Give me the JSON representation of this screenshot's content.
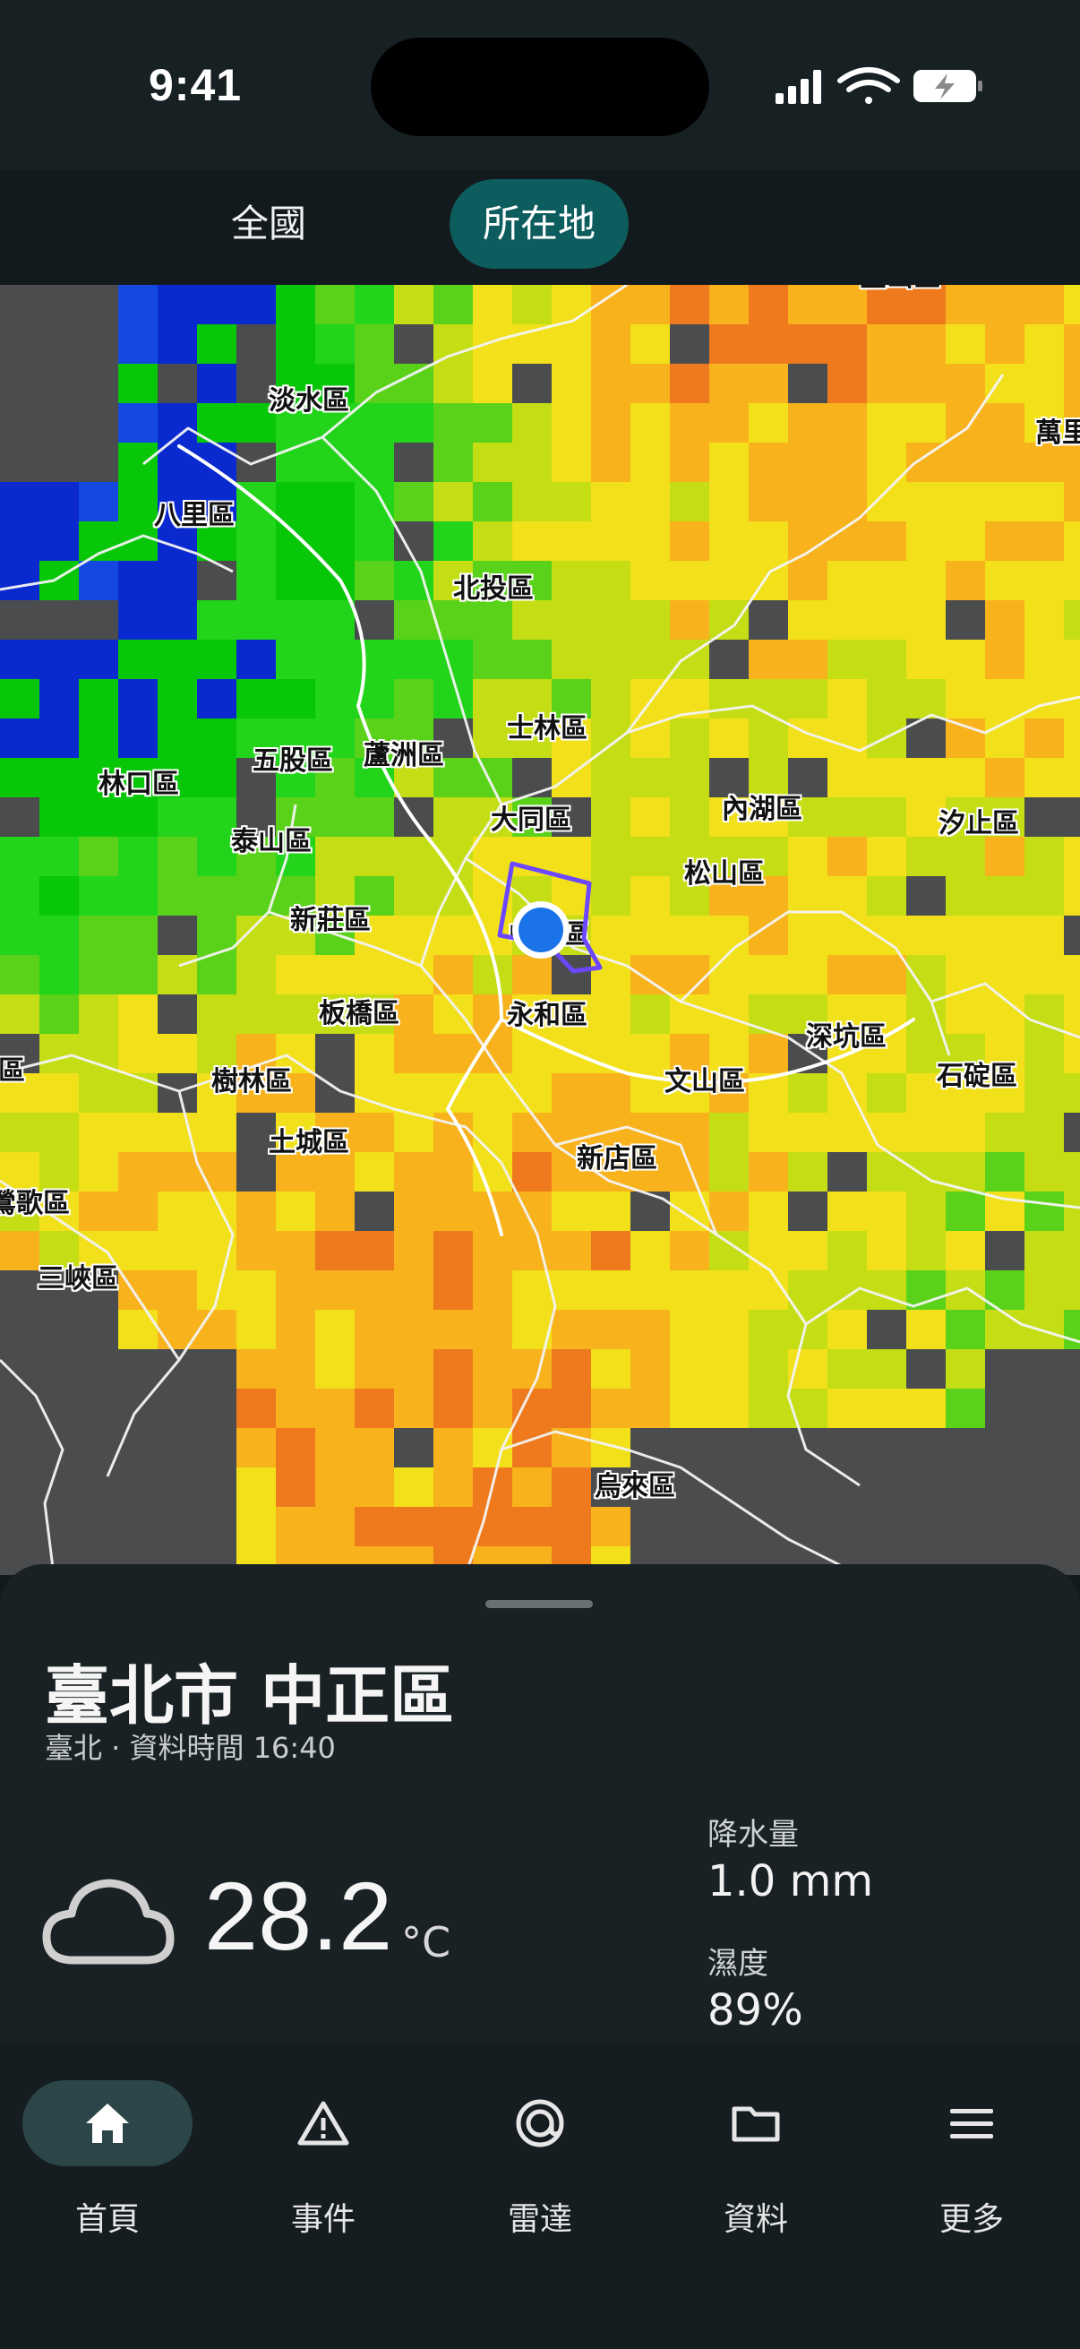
{
  "status_bar": {
    "time": "9:41",
    "icons": [
      "signal-icon",
      "wifi-icon",
      "battery-charging-icon"
    ]
  },
  "top_tabs": [
    {
      "label": "全國",
      "selected": false
    },
    {
      "label": "所在地",
      "selected": true
    }
  ],
  "map": {
    "layer": "radar-precipitation",
    "districts": [
      "淡水區",
      "萬里",
      "八里區",
      "北投區",
      "士林區",
      "五股區",
      "蘆洲區",
      "林口區",
      "大同區",
      "內湖區",
      "汐止區",
      "泰山區",
      "松山區",
      "新莊區",
      "中正區",
      "板橋區",
      "永和區",
      "深坑區",
      "石碇區",
      "樹林區",
      "文山區",
      "土城區",
      "新店區",
      "鶯歌區",
      "三峽區",
      "烏來區",
      "區",
      "金山區"
    ],
    "current_location_marker": "中正區"
  },
  "sheet": {
    "title": "臺北市 中正區",
    "subtitle": "臺北 · 資料時間 16:40",
    "weather_icon": "cloud-icon",
    "temperature": "28.2",
    "temperature_unit": "°C",
    "precip_label": "降水量",
    "precip_value": "1.0 mm",
    "humidity_label": "濕度",
    "humidity_value": "89%"
  },
  "bottom_nav": [
    {
      "label": "首頁",
      "icon": "home-icon",
      "active": true
    },
    {
      "label": "事件",
      "icon": "warning-icon",
      "active": false
    },
    {
      "label": "雷達",
      "icon": "radar-icon",
      "active": false
    },
    {
      "label": "資料",
      "icon": "folder-icon",
      "active": false
    },
    {
      "label": "更多",
      "icon": "menu-icon",
      "active": false
    }
  ],
  "colors": {
    "accent": "#0d5c5e",
    "nav_active_pill": "#2c4548",
    "location_marker": "#1a73e8",
    "location_outline": "#6b48ff"
  }
}
